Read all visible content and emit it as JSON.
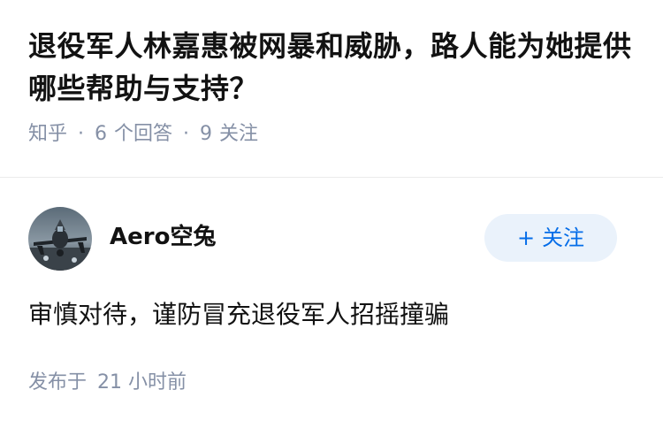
{
  "question": {
    "title": "退役军人林嘉惠被网暴和威胁，路人能为她提供哪些帮助与支持？",
    "site": "知乎",
    "answer_count": "6",
    "answer_label": "个回答",
    "follower_count": "9",
    "follower_label": "关注"
  },
  "answer": {
    "author": {
      "name": "Aero空兔",
      "follow_button": "关注",
      "follow_icon": "plus-icon"
    },
    "content": "审慎对待，谨防冒充退役军人招摇撞骗",
    "time_label": "发布于",
    "time_value": "21 小时前"
  },
  "colors": {
    "text_primary": "#121212",
    "text_meta": "#8590a6",
    "accent": "#056de8",
    "follow_bg": "#eaf2fb",
    "divider": "#ebebeb"
  }
}
